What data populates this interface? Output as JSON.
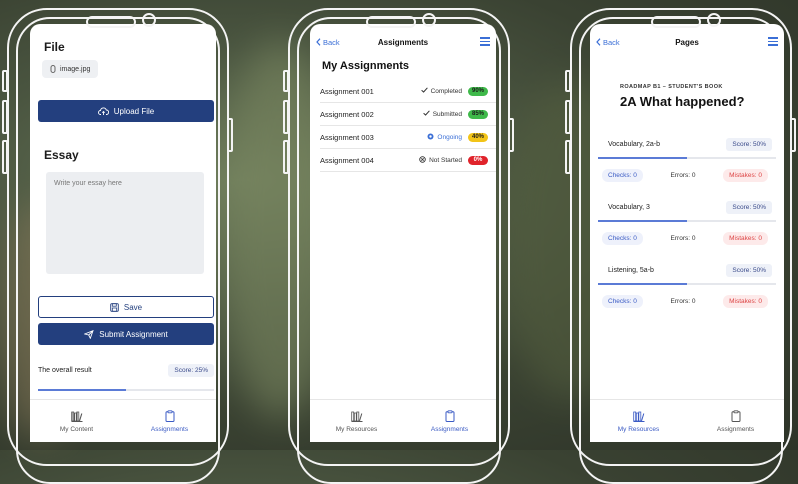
{
  "phone1": {
    "file_title": "File",
    "file_name": "image.jpg",
    "upload_label": "Upload File",
    "essay_title": "Essay",
    "essay_placeholder": "Write your essay here",
    "save_label": "Save",
    "submit_label": "Submit Assignment",
    "result_label": "The overall result",
    "result_score": "Score: 25%",
    "result_progress": 0.5,
    "tabs": [
      {
        "label": "My Content",
        "active": false
      },
      {
        "label": "Assignments",
        "active": true
      }
    ]
  },
  "phone2": {
    "back_label": "Back",
    "nav_title": "Assignments",
    "heading": "My Assignments",
    "assignments": [
      {
        "name": "Assignment 001",
        "status": "Completed",
        "percent": "90%",
        "color": "#3fb94a",
        "icon": "check-icon"
      },
      {
        "name": "Assignment 002",
        "status": "Submitted",
        "percent": "85%",
        "color": "#3fb94a",
        "icon": "check-icon"
      },
      {
        "name": "Assignment 003",
        "status": "Ongoing",
        "percent": "40%",
        "color": "#f2c418",
        "icon": "ongoing-icon"
      },
      {
        "name": "Assignment 004",
        "status": "Not Started",
        "percent": "0%",
        "color": "#e0232b",
        "icon": "not-started-icon"
      }
    ],
    "tabs": [
      {
        "label": "My Resources",
        "active": false
      },
      {
        "label": "Assignments",
        "active": true
      }
    ]
  },
  "phone3": {
    "back_label": "Back",
    "nav_title": "Pages",
    "book_label": "ROADMAP B1 – STUDENT'S BOOK",
    "page_title": "2A What happened?",
    "sections": [
      {
        "name": "Vocabulary, 2a-b",
        "score": "Score: 50%",
        "progress": 0.5,
        "checks": "Checks: 0",
        "errors": "Errors: 0",
        "mistakes": "Mistakes: 0"
      },
      {
        "name": "Vocabulary, 3",
        "score": "Score: 50%",
        "progress": 0.5,
        "checks": "Checks: 0",
        "errors": "Errors: 0",
        "mistakes": "Mistakes: 0"
      },
      {
        "name": "Listening, 5a-b",
        "score": "Score: 50%",
        "progress": 0.5,
        "checks": "Checks: 0",
        "errors": "Errors: 0",
        "mistakes": "Mistakes: 0"
      }
    ],
    "tabs": [
      {
        "label": "My Resources",
        "active": true
      },
      {
        "label": "Assignments",
        "active": false
      }
    ]
  },
  "colors": {
    "primary": "#233f7e",
    "accent": "#3b5bc4",
    "link": "#3b6fd6"
  }
}
